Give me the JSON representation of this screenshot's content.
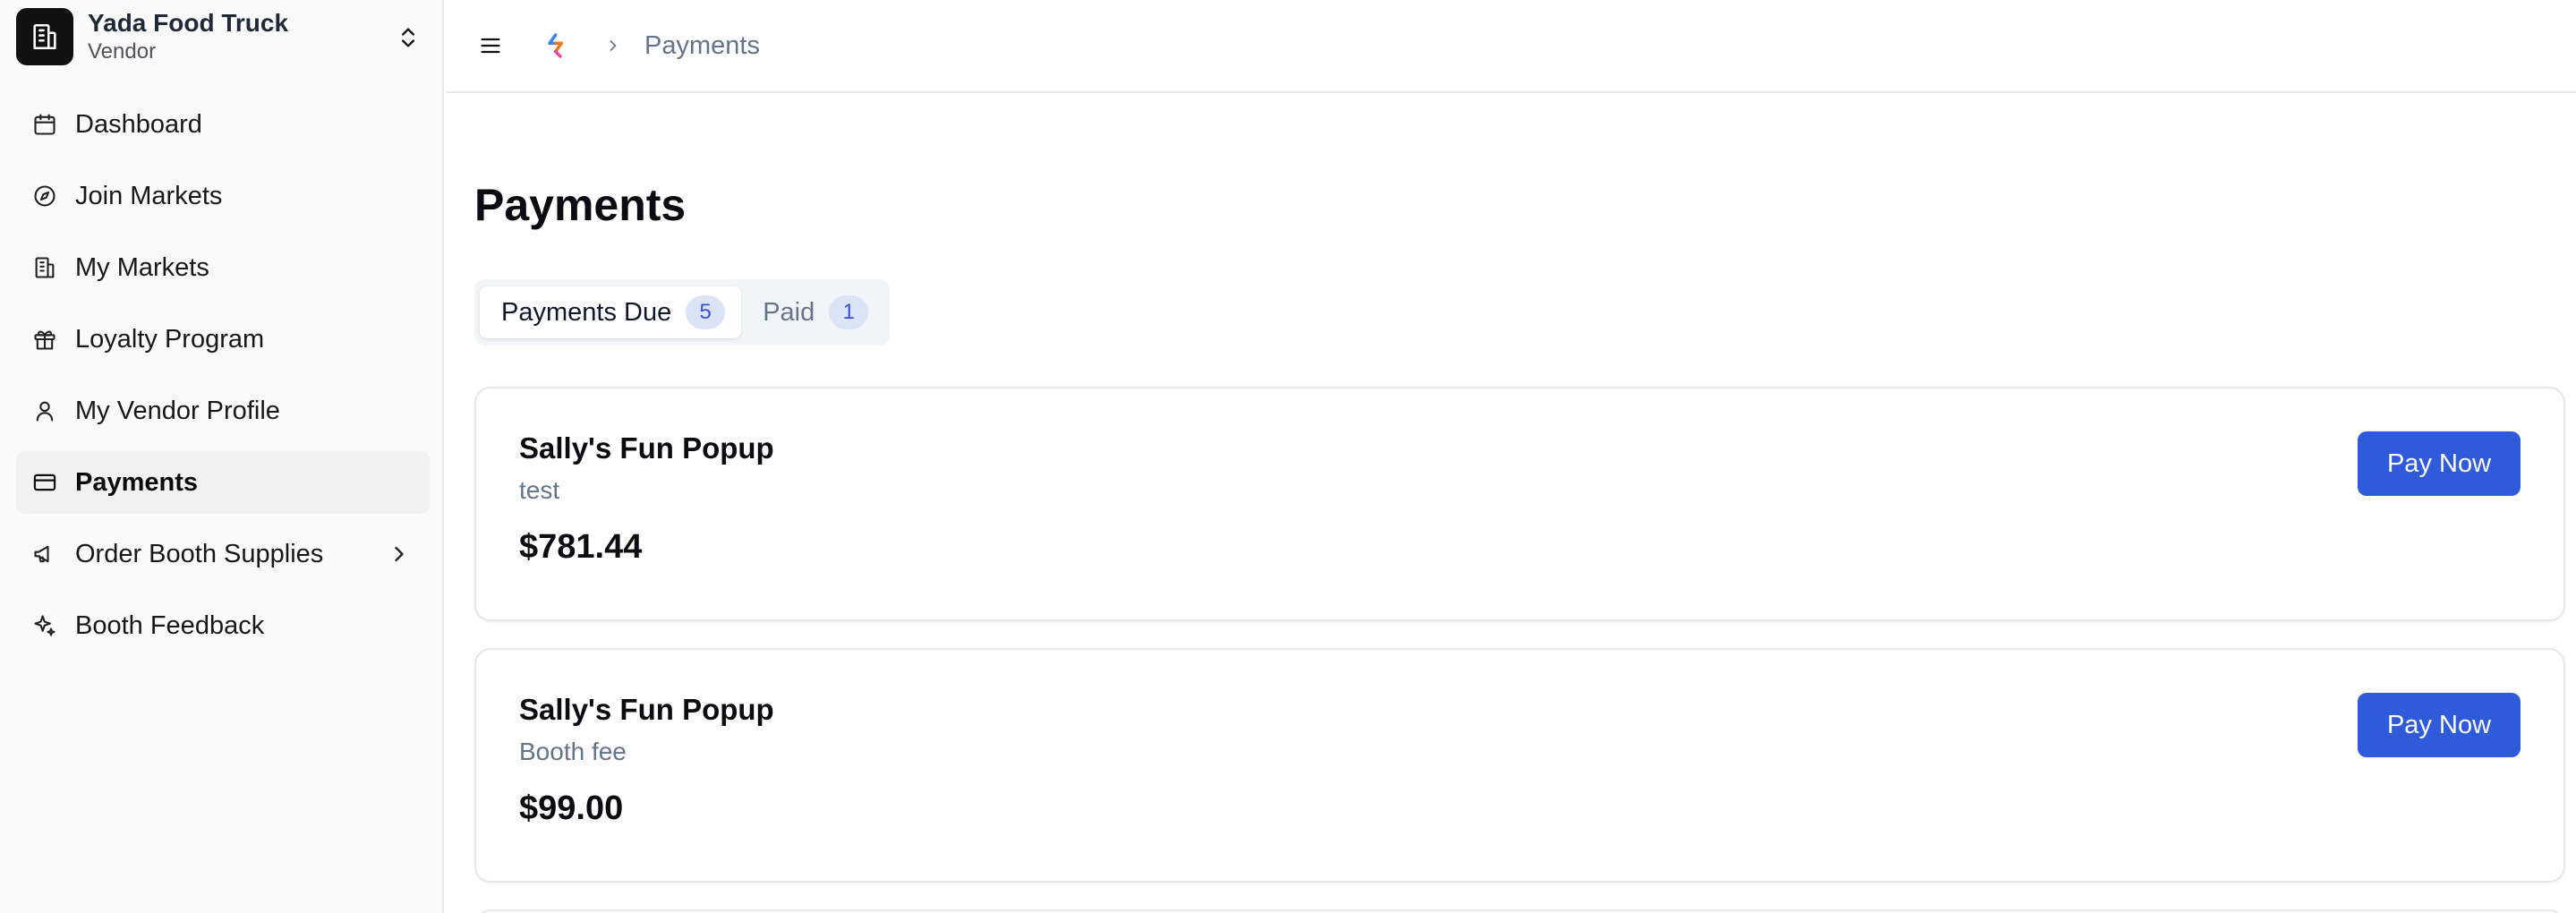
{
  "brand": {
    "name": "Yada Food Truck",
    "role": "Vendor"
  },
  "sidebar": {
    "items": [
      {
        "label": "Dashboard",
        "icon": "calendar-icon"
      },
      {
        "label": "Join Markets",
        "icon": "compass-icon"
      },
      {
        "label": "My Markets",
        "icon": "building-icon"
      },
      {
        "label": "Loyalty Program",
        "icon": "gift-icon"
      },
      {
        "label": "My Vendor Profile",
        "icon": "user-icon"
      },
      {
        "label": "Payments",
        "icon": "credit-card-icon",
        "active": true
      },
      {
        "label": "Order Booth Supplies",
        "icon": "megaphone-icon",
        "has_submenu": true
      },
      {
        "label": "Booth Feedback",
        "icon": "sparkles-icon"
      }
    ]
  },
  "breadcrumb": {
    "current": "Payments"
  },
  "page": {
    "title": "Payments"
  },
  "tabs": [
    {
      "label": "Payments Due",
      "count": "5",
      "active": true
    },
    {
      "label": "Paid",
      "count": "1",
      "active": false
    }
  ],
  "payments": [
    {
      "market": "Sally's Fun Popup",
      "description": "test",
      "amount": "$781.44",
      "button": "Pay Now"
    },
    {
      "market": "Sally's Fun Popup",
      "description": "Booth fee",
      "amount": "$99.00",
      "button": "Pay Now"
    }
  ],
  "colors": {
    "accent": "#2f5ad9",
    "badge_bg": "#dbe4f7",
    "badge_text": "#3b4fd8"
  }
}
